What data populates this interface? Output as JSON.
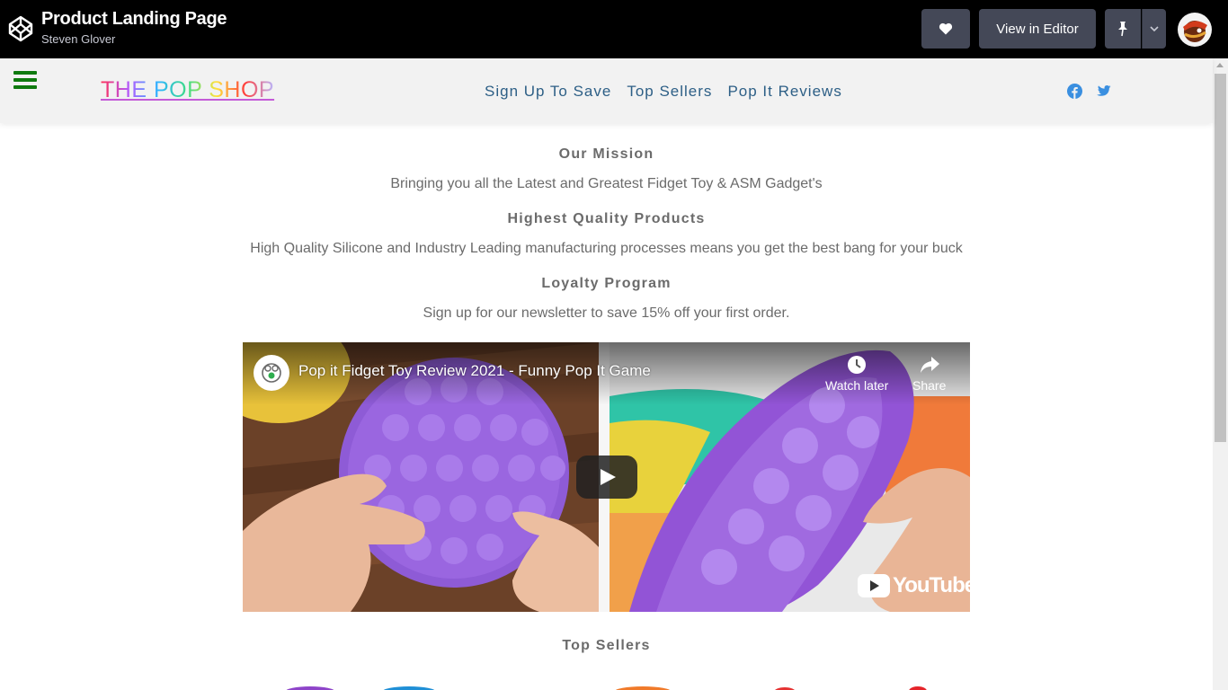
{
  "codepen": {
    "title": "Product Landing Page",
    "author": "Steven Glover",
    "view_in_editor": "View in Editor"
  },
  "navbar": {
    "brand": "THE POP SHOP",
    "links": [
      "Sign Up To Save",
      "Top Sellers",
      "Pop It Reviews"
    ]
  },
  "content": {
    "mission_heading": "Our Mission",
    "mission_text": "Bringing you all the Latest and Greatest Fidget Toy & ASM Gadget's",
    "quality_heading": "Highest Quality Products",
    "quality_text": "High Quality Silicone and Industry Leading manufacturing processes means you get the best bang for your buck",
    "loyalty_heading": "Loyalty Program",
    "loyalty_text": "Sign up for our newsletter to save 15% off your first order."
  },
  "video": {
    "title": "Pop it Fidget Toy Review 2021 - Funny Pop It Game",
    "watch_later": "Watch later",
    "share": "Share",
    "brand": "YouTube"
  },
  "top_sellers": {
    "heading": "Top Sellers"
  },
  "colors": {
    "codepen_bar": "#000000",
    "button_bg": "#444857",
    "nav_bg": "#f2f2f2",
    "link": "#2d5f86",
    "hamburger": "#0f7a0f",
    "text": "#6b6b6b"
  }
}
